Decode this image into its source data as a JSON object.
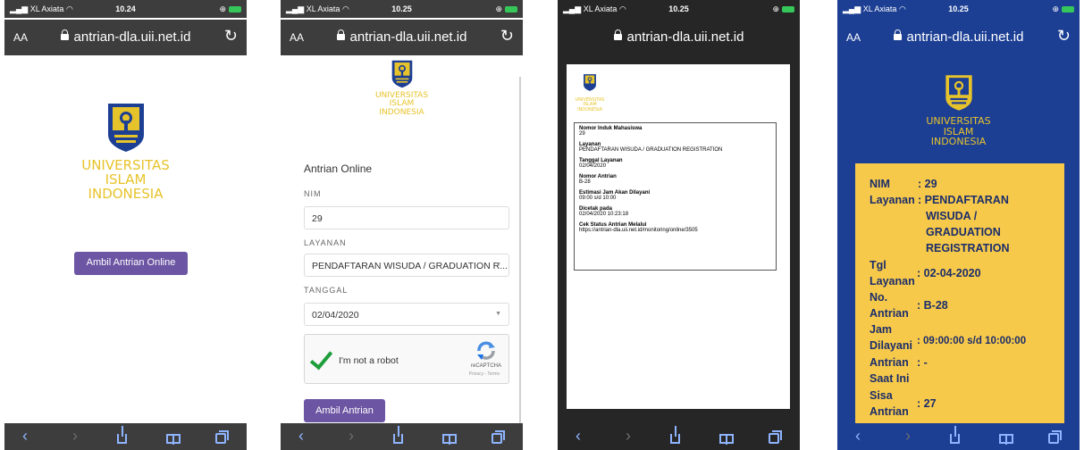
{
  "status": {
    "carrier": "XL Axiata",
    "times": [
      "10.24",
      "10.25",
      "10.25",
      "10.25"
    ]
  },
  "browser": {
    "aa": "AA",
    "url": "antrian-dla.uii.net.id"
  },
  "university": {
    "line1": "UNIVERSITAS",
    "line2": "ISLAM",
    "line3": "INDONESIA"
  },
  "landing": {
    "button_label": "Ambil Antrian Online"
  },
  "form": {
    "title": "Antrian Online",
    "nim_label": "NIM",
    "nim_value": "29",
    "layanan_label": "LAYANAN",
    "layanan_value": "PENDAFTARAN WISUDA / GRADUATION R...",
    "tanggal_label": "TANGGAL",
    "tanggal_value": "02/04/2020",
    "captcha_text": "I'm not a robot",
    "captcha_brand": "reCAPTCHA",
    "captcha_links": "Privacy - Terms",
    "submit_label": "Ambil Antrian"
  },
  "ticket": {
    "items": [
      {
        "label": "Nomor Induk Mahasiswa",
        "value": "29"
      },
      {
        "label": "Layanan",
        "value": "PENDAFTARAN WISUDA / GRADUATION REGISTRATION"
      },
      {
        "label": "Tanggal Layanan",
        "value": "02/04/2020"
      },
      {
        "label": "Nomor Antrian",
        "value": "B-28"
      },
      {
        "label": "Estimasi Jam Akan Dilayani",
        "value": "09:00 s/d 10:00"
      },
      {
        "label": "Dicetak pada",
        "value": "02/04/2020 10:23:18"
      },
      {
        "label": "Cek Status Antrian Melalui",
        "value": "https://antrian-dla.uii.net.id/monitoring/online/3505"
      }
    ]
  },
  "status_card": {
    "nim_label": "NIM",
    "nim_value": ": 29",
    "layanan_label": "Layanan",
    "layanan_value_1": ": PENDAFTARAN",
    "layanan_value_2": "WISUDA /",
    "layanan_value_3": "GRADUATION",
    "layanan_value_4": "REGISTRATION",
    "tgl_label_1": "Tgl",
    "tgl_label_2": "Layanan",
    "tgl_value": ": 02-04-2020",
    "no_label_1": "No.",
    "no_label_2": "Antrian",
    "no_value": ": B-28",
    "jam_label_1": "Jam",
    "jam_label_2": "Dilayani",
    "jam_value": ": 09:00:00 s/d 10:00:00",
    "saat_label_1": "Antrian",
    "saat_label_2": "Saat Ini",
    "saat_value": ": -",
    "sisa_label_1": "Sisa",
    "sisa_label_2": "Antrian",
    "sisa_value": ": 27"
  },
  "colors": {
    "accent_purple": "#6c55a3",
    "uii_yellow": "#e7c32b",
    "card_yellow": "#f7c94a",
    "uii_blue": "#1c3f94"
  },
  "icons": [
    "signal-icon",
    "wifi-icon",
    "battery-icon",
    "lock-icon",
    "reload-icon",
    "back-icon",
    "forward-icon",
    "share-icon",
    "bookmarks-icon",
    "tabs-icon",
    "recaptcha-icon",
    "uii-emblem-icon"
  ]
}
